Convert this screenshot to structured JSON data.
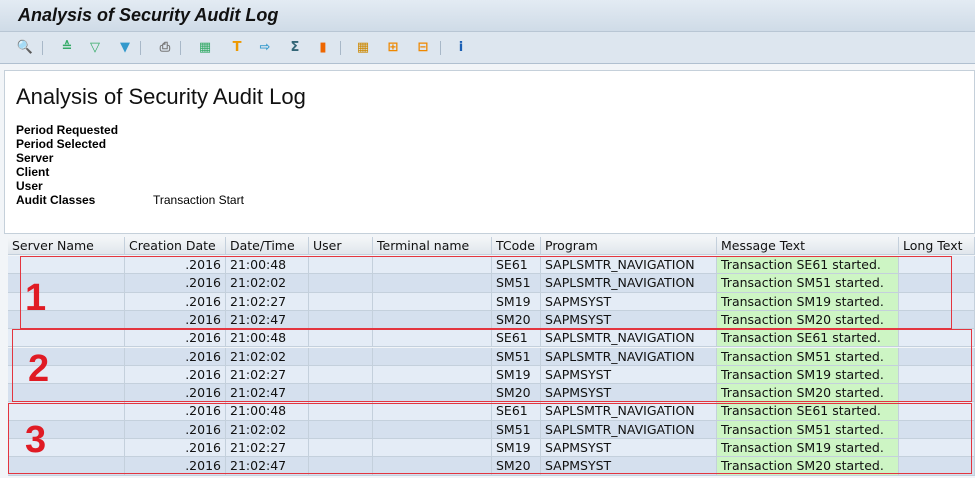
{
  "window": {
    "title": "Analysis of Security Audit Log"
  },
  "toolbar": {
    "icons": [
      "details-icon",
      "sort-ascending-icon",
      "sort-descending-icon",
      "filter-icon",
      "print-preview-icon",
      "export-spreadsheet-icon",
      "word-processing-icon",
      "local-file-icon",
      "abc-analysis-icon",
      "graphic-icon",
      "change-layout-icon",
      "select-layout-icon",
      "save-layout-icon",
      "information-icon"
    ]
  },
  "header": {
    "title": "Analysis of Security Audit Log",
    "fields": [
      {
        "label": "Period Requested",
        "value": ""
      },
      {
        "label": "Period Selected",
        "value": ""
      },
      {
        "label": "Server",
        "value": ""
      },
      {
        "label": "Client",
        "value": ""
      },
      {
        "label": "User",
        "value": ""
      },
      {
        "label": "Audit Classes",
        "value": "Transaction Start"
      }
    ]
  },
  "table": {
    "columns": [
      "Server Name",
      "Creation Date",
      "Date/Time",
      "User",
      "Terminal name",
      "TCode",
      "Program",
      "Message Text",
      "Long Text"
    ],
    "rows": [
      [
        ".2016",
        "21:00:48",
        "SE61",
        "SAPLSMTR_NAVIGATION",
        "Transaction SE61 started."
      ],
      [
        ".2016",
        "21:02:02",
        "SM51",
        "SAPLSMTR_NAVIGATION",
        "Transaction SM51 started."
      ],
      [
        ".2016",
        "21:02:27",
        "SM19",
        "SAPMSYST",
        "Transaction SM19 started."
      ],
      [
        ".2016",
        "21:02:47",
        "SM20",
        "SAPMSYST",
        "Transaction SM20 started."
      ],
      [
        ".2016",
        "21:00:48",
        "SE61",
        "SAPLSMTR_NAVIGATION",
        "Transaction SE61 started."
      ],
      [
        ".2016",
        "21:02:02",
        "SM51",
        "SAPLSMTR_NAVIGATION",
        "Transaction SM51 started."
      ],
      [
        ".2016",
        "21:02:27",
        "SM19",
        "SAPMSYST",
        "Transaction SM19 started."
      ],
      [
        ".2016",
        "21:02:47",
        "SM20",
        "SAPMSYST",
        "Transaction SM20 started."
      ],
      [
        ".2016",
        "21:00:48",
        "SE61",
        "SAPLSMTR_NAVIGATION",
        "Transaction SE61 started."
      ],
      [
        ".2016",
        "21:02:02",
        "SM51",
        "SAPLSMTR_NAVIGATION",
        "Transaction SM51 started."
      ],
      [
        ".2016",
        "21:02:27",
        "SM19",
        "SAPMSYST",
        "Transaction SM19 started."
      ],
      [
        ".2016",
        "21:02:47",
        "SM20",
        "SAPMSYST",
        "Transaction SM20 started."
      ]
    ]
  },
  "annotations": [
    "1",
    "2",
    "3"
  ]
}
